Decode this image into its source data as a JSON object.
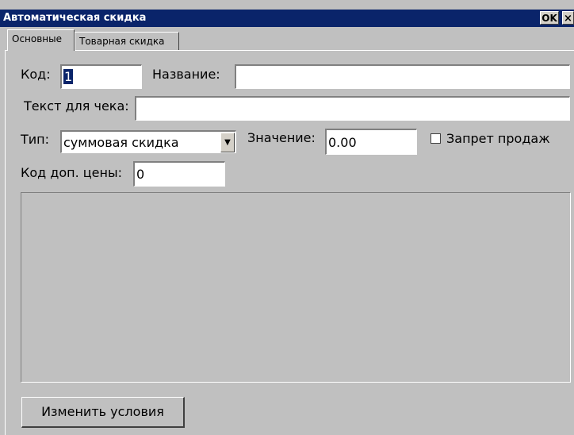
{
  "window": {
    "title": "Автоматическая скидка",
    "ok_label": "OK",
    "close_label": "×"
  },
  "tabs": [
    {
      "label": "Основные",
      "active": true
    },
    {
      "label": "Товарная скидка",
      "active": false
    }
  ],
  "form": {
    "code_label": "Код:",
    "code_value": "1",
    "name_label": "Название:",
    "name_value": "",
    "receipt_text_label": "Текст для чека:",
    "receipt_text_value": "",
    "type_label": "Тип:",
    "type_value": "суммовая скидка",
    "value_label": "Значение:",
    "value_value": "0.00",
    "sales_ban_label": "Запрет продаж",
    "sales_ban_checked": false,
    "extra_price_code_label": "Код доп. цены:",
    "extra_price_code_value": "0"
  },
  "buttons": {
    "change_conditions_label": "Изменить условия"
  }
}
